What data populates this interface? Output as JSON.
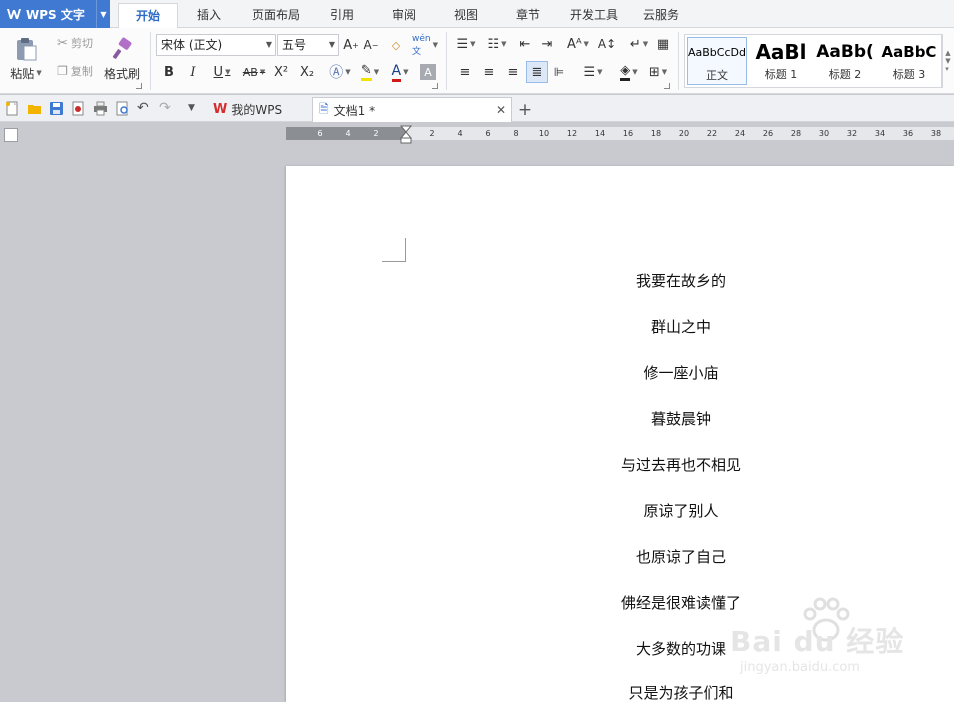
{
  "app": {
    "title": "WPS 文字"
  },
  "tabs": [
    {
      "label": "开始",
      "active": true
    },
    {
      "label": "插入"
    },
    {
      "label": "页面布局"
    },
    {
      "label": "引用"
    },
    {
      "label": "审阅"
    },
    {
      "label": "视图"
    },
    {
      "label": "章节"
    },
    {
      "label": "开发工具"
    },
    {
      "label": "云服务"
    }
  ],
  "ribbon": {
    "paste_label": "粘贴",
    "cut_label": "剪切",
    "copy_label": "复制",
    "format_painter_label": "格式刷",
    "font_name": "宋体 (正文)",
    "font_size": "五号",
    "bold": "B",
    "italic": "I",
    "underline": "U",
    "strike": "AB",
    "superscript": "X²",
    "subscript": "X₂",
    "font_color_letter": "A",
    "styles": [
      {
        "preview": "AaBbCcDd",
        "name": "正文",
        "selected": true
      },
      {
        "preview": "AaBl",
        "name": "标题 1"
      },
      {
        "preview": "AaBb(",
        "name": "标题 2"
      },
      {
        "preview": "AaBbC",
        "name": "标题 3"
      }
    ],
    "accent_color": "#3f79d1"
  },
  "quickbar": {
    "doc_tabs": [
      {
        "label": "我的WPS"
      },
      {
        "label": "文档1 *",
        "active": true
      }
    ],
    "new_tab": "+"
  },
  "ruler": {
    "left_ticks": [
      "6",
      "4",
      "2"
    ],
    "right_ticks": [
      "2",
      "4",
      "6",
      "8",
      "10",
      "12",
      "14",
      "16",
      "18",
      "20",
      "22",
      "24",
      "26",
      "28",
      "30",
      "32",
      "34",
      "36",
      "38"
    ]
  },
  "document": {
    "lines": [
      "我要在故乡的",
      "群山之中",
      "修一座小庙",
      "暮鼓晨钟",
      "与过去再也不相见",
      "原谅了别人",
      "也原谅了自己",
      "佛经是很难读懂了",
      "大多数的功课",
      "只是为孩子们和"
    ]
  },
  "watermark": {
    "text": "Bai du 经验",
    "url": "jingyan.baidu.com"
  }
}
